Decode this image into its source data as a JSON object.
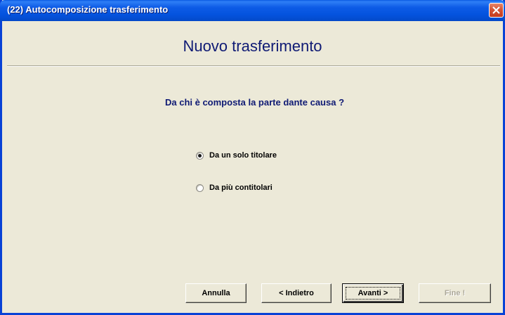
{
  "window": {
    "title": "(22) Autocomposizione trasferimento"
  },
  "header": {
    "title": "Nuovo trasferimento"
  },
  "main": {
    "question": "Da chi è composta la parte dante causa ?",
    "options": [
      {
        "label": "Da un solo titolare",
        "selected": true
      },
      {
        "label": "Da più contitolari",
        "selected": false
      }
    ]
  },
  "buttons": {
    "cancel": "Annulla",
    "back": "< Indietro",
    "next": "Avanti >",
    "finish": "Fine !"
  },
  "colors": {
    "accent_text": "#0f1a74",
    "titlebar": "#0453de",
    "window_bg": "#ece9d8"
  }
}
